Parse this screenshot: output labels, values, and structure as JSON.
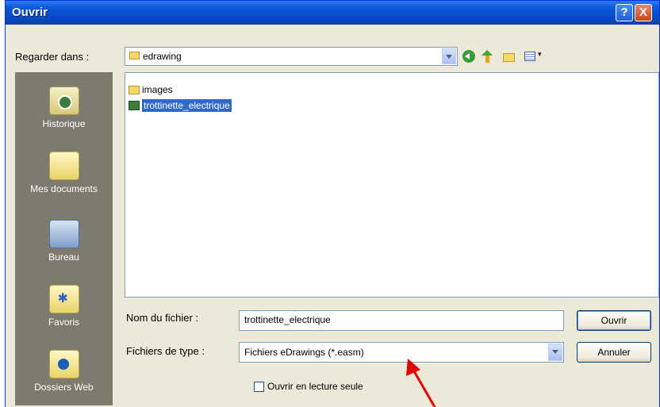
{
  "dialog": {
    "title": "Ouvrir",
    "help_label": "?",
    "close_label": "X"
  },
  "lookin": {
    "label": "Regarder dans :",
    "value": "edrawing"
  },
  "places": [
    {
      "label": "Historique",
      "icon": "history-icon"
    },
    {
      "label": "Mes documents",
      "icon": "my-documents-icon"
    },
    {
      "label": "Bureau",
      "icon": "desktop-icon"
    },
    {
      "label": "Favoris",
      "icon": "favorites-icon"
    },
    {
      "label": "Dossiers Web",
      "icon": "web-folders-icon"
    }
  ],
  "files": [
    {
      "name": "images",
      "type": "folder",
      "selected": false
    },
    {
      "name": "trottinette_electrique",
      "type": "edrawing",
      "selected": true
    }
  ],
  "filename": {
    "label": "Nom du fichier :",
    "value": "trottinette_electrique"
  },
  "filetype": {
    "label": "Fichiers de type :",
    "value": "Fichiers eDrawings (*.easm)"
  },
  "buttons": {
    "open": "Ouvrir",
    "cancel": "Annuler"
  },
  "readonly": {
    "label": "Ouvrir en lecture seule",
    "checked": false
  },
  "annotation": {
    "arrow_color": "#e00000"
  }
}
